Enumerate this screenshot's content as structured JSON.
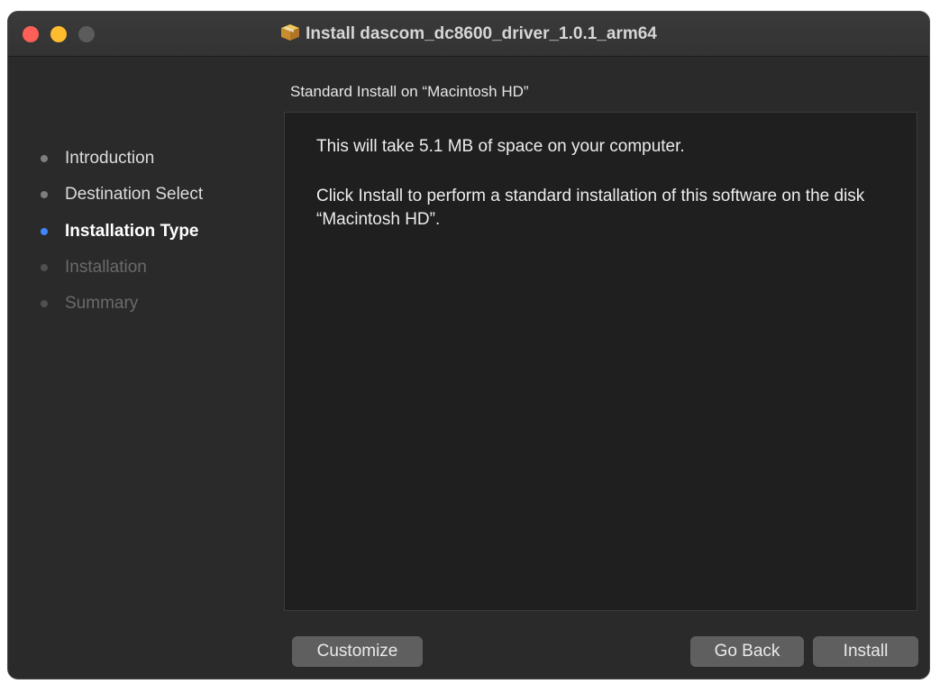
{
  "window": {
    "title": "Install dascom_dc8600_driver_1.0.1_arm64",
    "title_icon": "package-icon"
  },
  "sidebar": {
    "steps": [
      {
        "label": "Introduction",
        "state": "done"
      },
      {
        "label": "Destination Select",
        "state": "done"
      },
      {
        "label": "Installation Type",
        "state": "current"
      },
      {
        "label": "Installation",
        "state": "pending"
      },
      {
        "label": "Summary",
        "state": "pending"
      }
    ]
  },
  "main": {
    "heading": "Standard Install on “Macintosh HD”",
    "space_text": "This will take 5.1 MB of space on your computer.",
    "instruction_text": "Click Install to perform a standard installation of this software on the disk “Macintosh HD”."
  },
  "buttons": {
    "customize": "Customize",
    "go_back": "Go Back",
    "install": "Install"
  },
  "colors": {
    "current_step_dot": "#3f86ff",
    "close": "#fe5f57",
    "minimize": "#febc2e"
  }
}
